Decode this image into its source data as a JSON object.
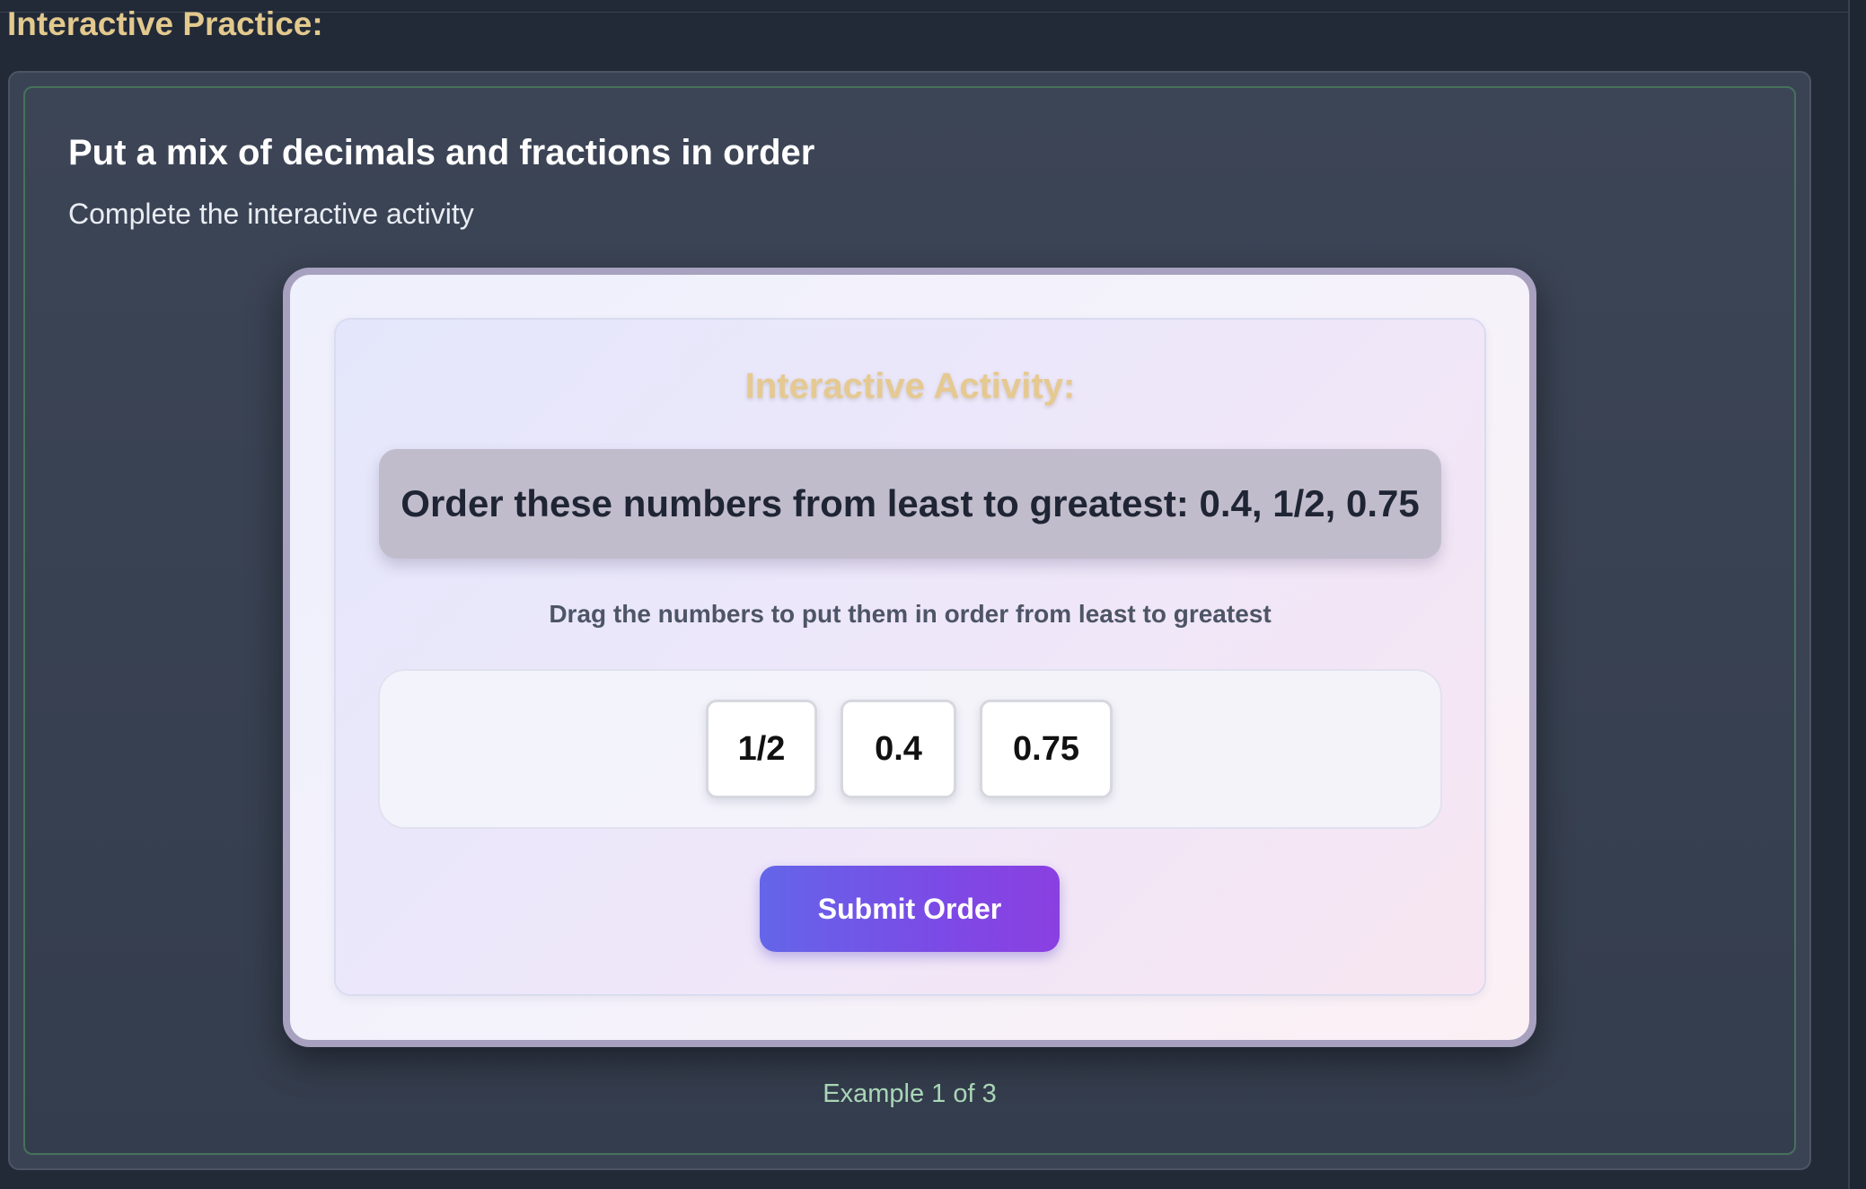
{
  "section": {
    "heading": "Interactive Practice:"
  },
  "practice": {
    "title": "Put a mix of decimals and fractions in order",
    "subtitle": "Complete the interactive activity"
  },
  "activity": {
    "heading": "Interactive Activity:",
    "question": "Order these numbers from least to greatest: 0.4, 1/2, 0.75",
    "instruction": "Drag the numbers to put them in order from least to greatest",
    "tiles": [
      "1/2",
      "0.4",
      "0.75"
    ],
    "submit_label": "Submit Order"
  },
  "progress": {
    "text": "Example 1 of 3"
  },
  "colors": {
    "page_background": "#222a38",
    "heading_gold": "#e3c98d",
    "panel_border_green": "#46725c",
    "button_gradient_start": "#6366e9",
    "button_gradient_end": "#8b3fe1",
    "progress_text": "#a9d6b6"
  }
}
